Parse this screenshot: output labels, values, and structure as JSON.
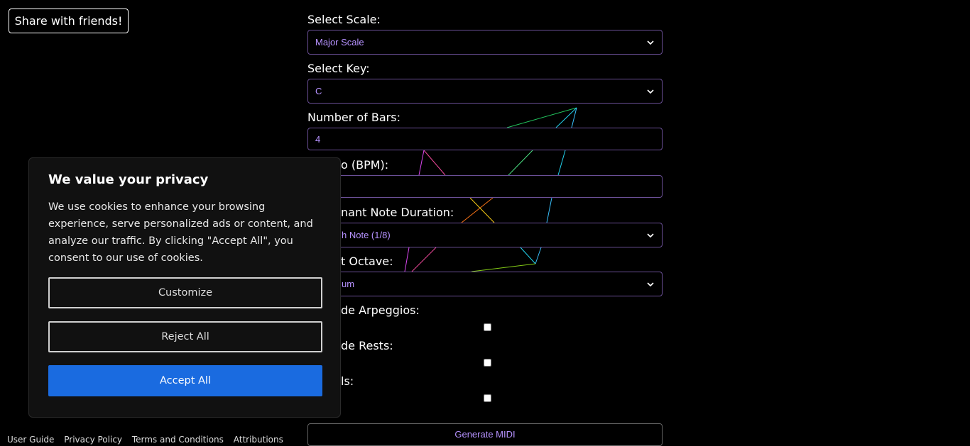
{
  "share_button": "Share with friends!",
  "form": {
    "scale_label": "Select Scale:",
    "scale_value": "Major Scale",
    "key_label": "Select Key:",
    "key_value": "C",
    "bars_label": "Number of Bars:",
    "bars_value": "4",
    "tempo_label": "o (BPM):",
    "tempo_value": "",
    "duration_label": "nant Note Duration:",
    "duration_value": "h Note (1/8)",
    "octave_label": "t Octave:",
    "octave_value": "um",
    "arpeggios_label": "de Arpeggios:",
    "rests_label": "de Rests:",
    "third_label": "ls:",
    "generate_button": "Generate MIDI"
  },
  "cookie": {
    "title": "We value your privacy",
    "body": "We use cookies to enhance your browsing experience, serve personalized ads or content, and analyze our traffic. By clicking \"Accept All\", you consent to our use of cookies.",
    "customize": "Customize",
    "reject": "Reject All",
    "accept": "Accept All",
    "accent_color": "#1a6be0"
  },
  "footer": {
    "links": [
      "User Guide",
      "Privacy Policy",
      "Terms and Conditions",
      "Attributions"
    ]
  }
}
